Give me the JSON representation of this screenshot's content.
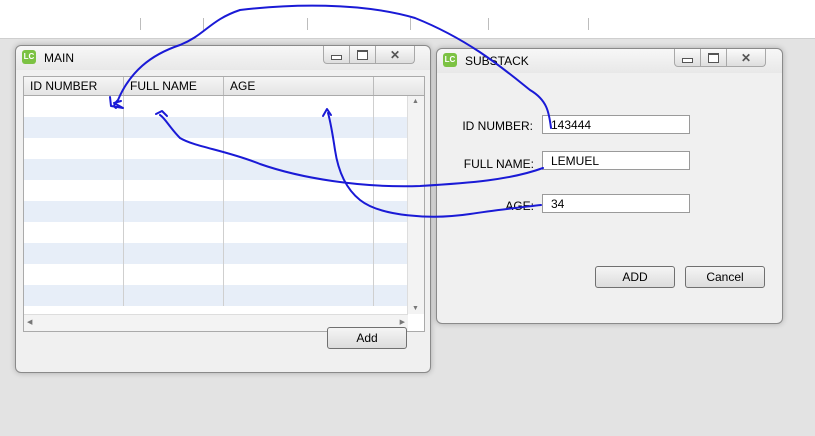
{
  "main_window": {
    "title": "MAIN",
    "icon_text": "LC",
    "columns": [
      "ID NUMBER",
      "FULL NAME",
      "AGE"
    ],
    "add_label": "Add"
  },
  "substack_window": {
    "title": "SUBSTACK",
    "icon_text": "LC",
    "id_label": "ID NUMBER:",
    "id_value": "143444",
    "name_label": "FULL NAME:",
    "name_value": "LEMUEL",
    "age_label": "AGE:",
    "age_value": "34",
    "add_label": "ADD",
    "cancel_label": "Cancel"
  },
  "colors": {
    "annotation": "#1a1ad6",
    "row_alt": "#e7eef8",
    "icon_green": "#7cc243"
  }
}
